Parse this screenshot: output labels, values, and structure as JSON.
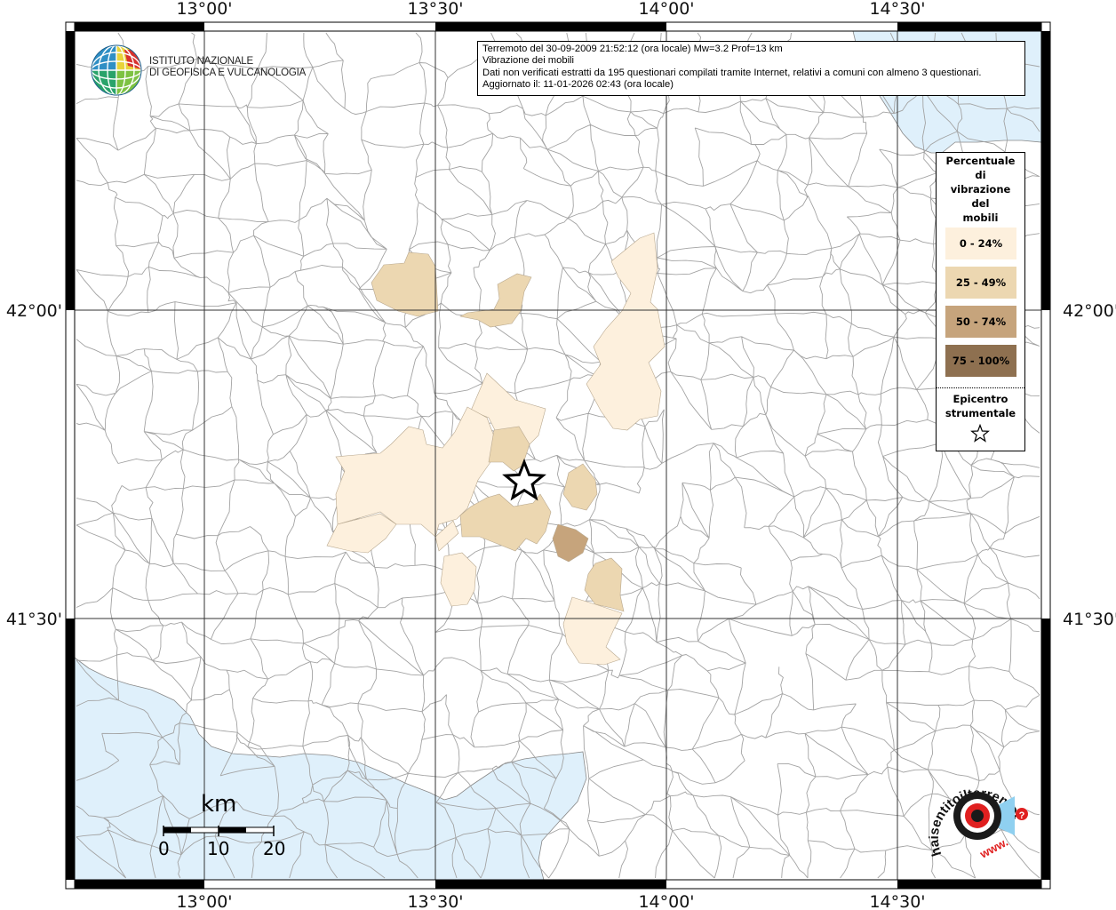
{
  "info": {
    "line1": "Terremoto del 30-09-2009 21:52:12 (ora locale) Mw=3.2 Prof=13 km",
    "line2": "Vibrazione dei mobili",
    "line3": "Dati non verificati estratti da 195 questionari compilati tramite Internet, relativi a comuni con almeno 3 questionari.",
    "line4": "Aggiornato il: 11-01-2026 02:43 (ora locale)"
  },
  "institute": {
    "line1": "ISTITUTO NAZIONALE",
    "line2": "DI GEOFISICA E VULCANOLOGIA"
  },
  "axes": {
    "lon_labels": [
      "13°00'",
      "13°30'",
      "14°00'",
      "14°30'"
    ],
    "lat_labels": [
      "42°00'",
      "41°30'"
    ]
  },
  "legend": {
    "title_lines": [
      "Percentuale",
      "di",
      "vibrazione",
      "del",
      "mobili"
    ],
    "classes": [
      {
        "label": "0 - 24%",
        "color": "#fdf0dd"
      },
      {
        "label": "25 - 49%",
        "color": "#ecd7b1"
      },
      {
        "label": "50 - 74%",
        "color": "#c6a47c"
      },
      {
        "label": "75 - 100%",
        "color": "#8e7050"
      }
    ],
    "epicenter_lines": [
      "Epicentro",
      "strumentale"
    ]
  },
  "scale": {
    "title": "km",
    "ticks": [
      "0",
      "10",
      "20"
    ]
  },
  "hsi_logo": {
    "text_ring": "haisentitoilterremoto.it",
    "url_text": "www.",
    "question_mark": "?"
  },
  "colors": {
    "sea": "#dff0fb",
    "grid": "#333333",
    "boundary": "#9a9a9a",
    "frame": "#000000"
  },
  "icons": {
    "epicenter": "star-icon",
    "logo": "globe-icon"
  }
}
